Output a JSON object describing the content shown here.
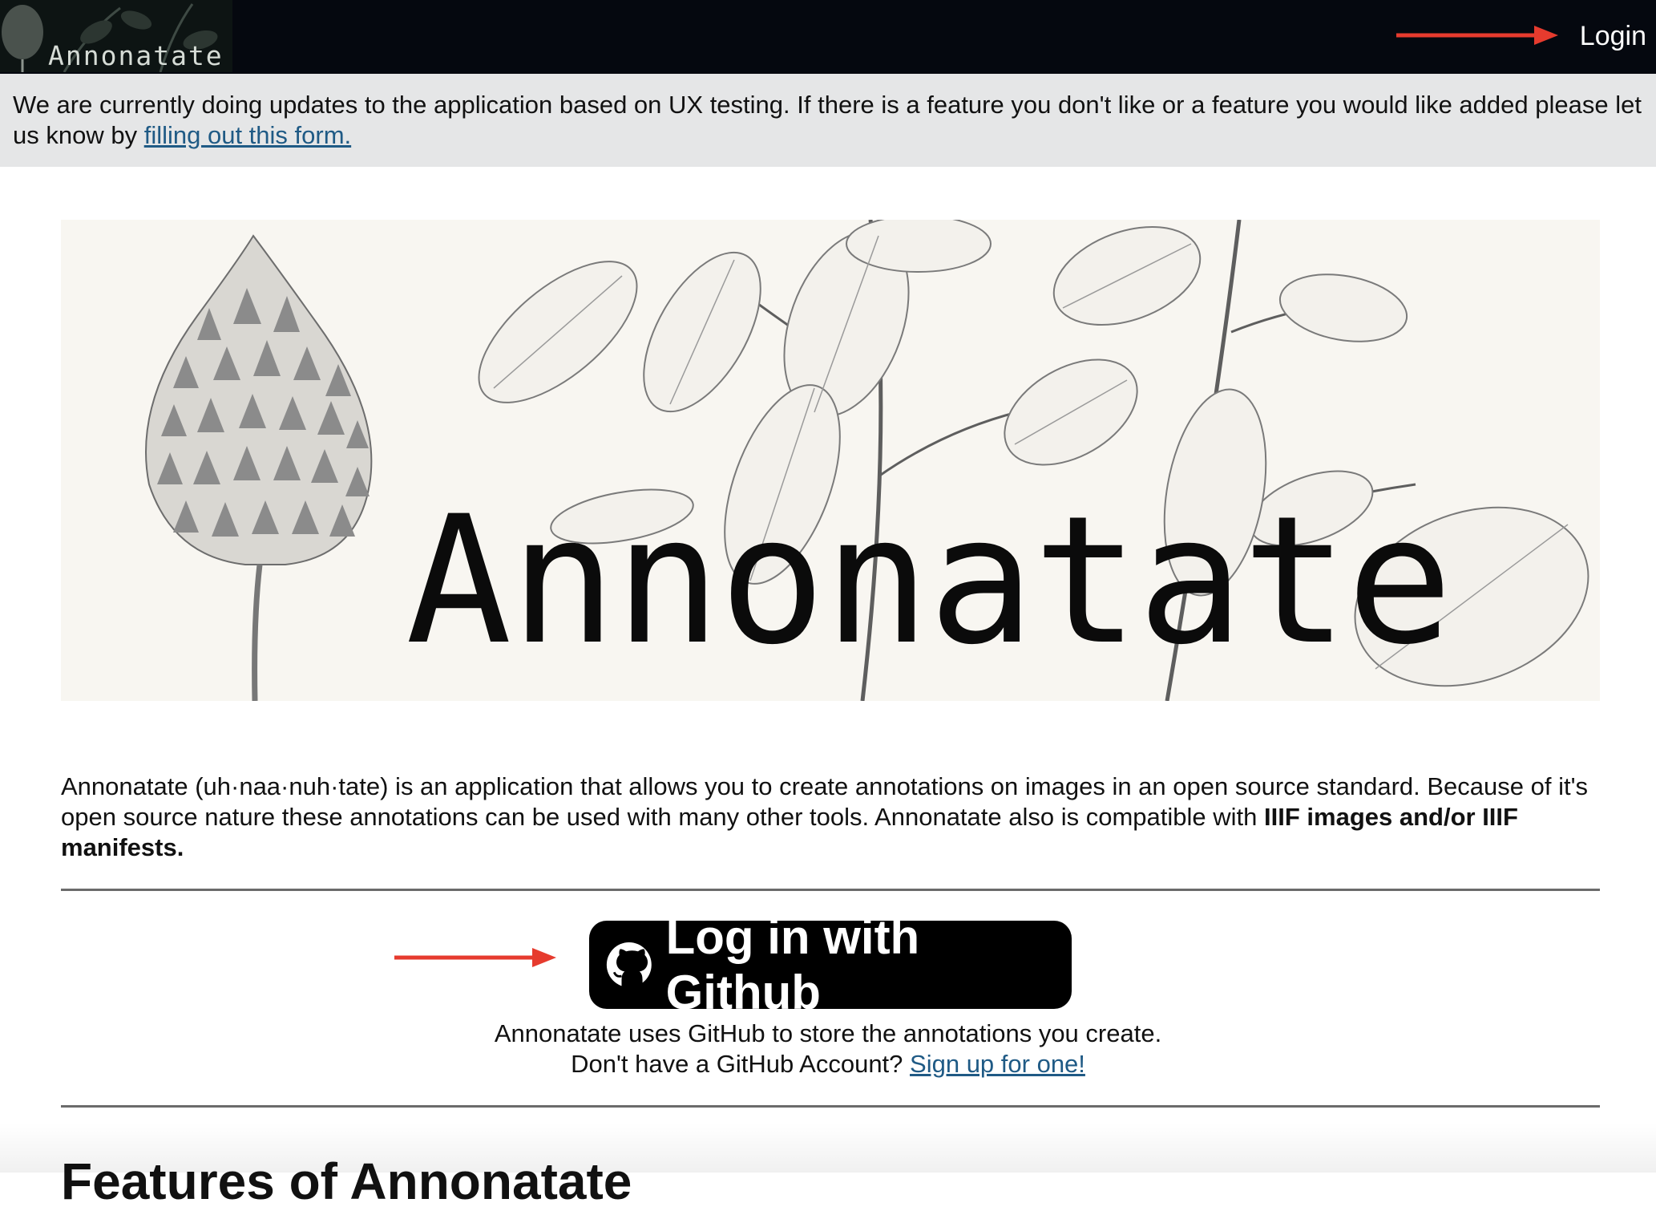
{
  "header": {
    "logo_text": "Annonatate",
    "login_label": "Login",
    "accent_color": "#e63b2e"
  },
  "notice": {
    "text": "We are currently doing updates to the application based on UX testing. If there is a feature you don't like or a feature you would like added please let us know by ",
    "link_label": "filling out this form."
  },
  "hero": {
    "title": "Annonatate"
  },
  "intro": {
    "text": "Annonatate (uh·naa·nuh·tate) is an application that allows you to create annotations on images in an open source standard. Because of it's open source nature these annotations can be used with many other tools. Annonatate also is compatible with ",
    "bold_text": "IIIF images and/or IIIF manifests."
  },
  "login_section": {
    "button_label": "Log in with Github",
    "icon": "github-icon",
    "info_text": "Annonatate uses GitHub to store the annotations you create.",
    "signup_prompt": "Don't have a GitHub Account? ",
    "signup_link": "Sign up for one!"
  },
  "features": {
    "heading": "Features of Annonatate"
  }
}
